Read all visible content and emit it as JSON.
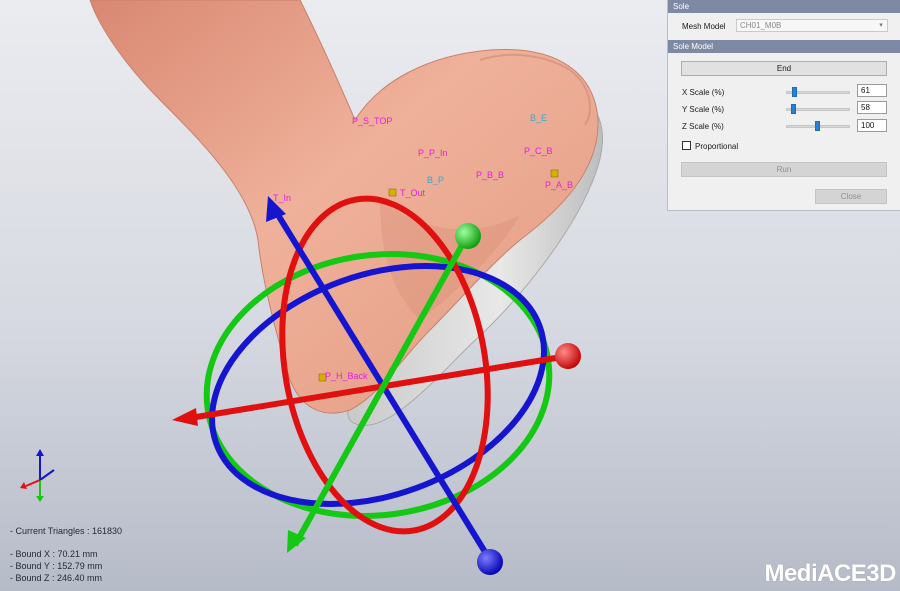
{
  "panel": {
    "sole_header": "Sole",
    "mesh_model_label": "Mesh Model",
    "mesh_model_value": "CH01_M0B",
    "sole_model_header": "Sole Model",
    "end_button": "End",
    "x_scale_label": "X Scale (%)",
    "x_scale_value": "61",
    "y_scale_label": "Y Scale (%)",
    "y_scale_value": "58",
    "z_scale_label": "Z Scale (%)",
    "z_scale_value": "100",
    "proportional_label": "Proportional",
    "proportional_checked": false,
    "run_button": "Run",
    "close_button": "Close"
  },
  "landmarks": [
    {
      "text": "P_S_TOP",
      "color": "pink"
    },
    {
      "text": "B_E",
      "color": "cyan"
    },
    {
      "text": "P_P_In",
      "color": "pink"
    },
    {
      "text": "P_C_B",
      "color": "pink"
    },
    {
      "text": "B_P",
      "color": "cyan"
    },
    {
      "text": "P_B_B",
      "color": "pink"
    },
    {
      "text": "P_A_B",
      "color": "pink"
    },
    {
      "text": "T_Out",
      "color": "pink"
    },
    {
      "text": "T_In",
      "color": "pink"
    },
    {
      "text": "P_H_Back",
      "color": "pink"
    }
  ],
  "stats": {
    "triangles": "- Current Triangles : 161830",
    "bound_x": "- Bound X : 70.21 mm",
    "bound_y": "- Bound Y : 152.79 mm",
    "bound_z": "- Bound Z : 246.40 mm"
  },
  "logo": "MediACE3D",
  "colors": {
    "axis_red": "#e01010",
    "axis_green": "#14c814",
    "axis_blue": "#1010e0",
    "skin": "#e8a08a",
    "panel_header": "#7e8aa4",
    "slider_accent": "#2a7fd4"
  }
}
